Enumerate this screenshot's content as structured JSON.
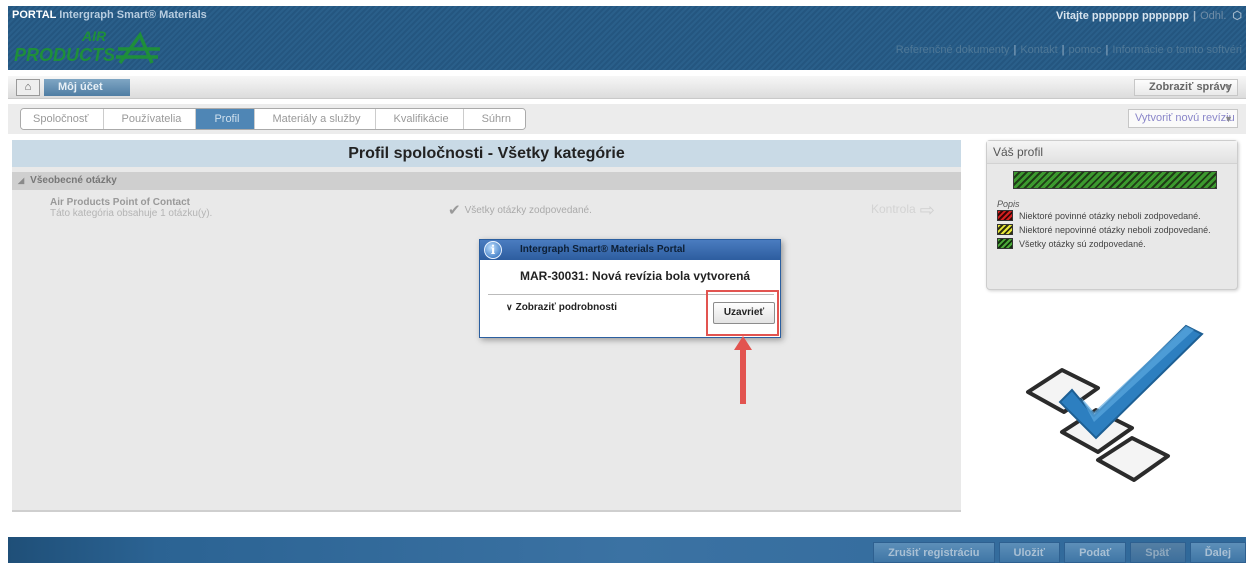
{
  "header": {
    "portal_label": "PORTAL",
    "app_name": "Intergraph Smart® Materials",
    "logo_text_top": "AIR",
    "logo_text_bottom": "PRODUCTS",
    "welcome": "Vitajte ppppppp ppppppp",
    "logout": "Odhl.",
    "links": [
      "Referenčné dokumenty",
      "Kontakt",
      "pomoc",
      "Informácie o tomto softvéri"
    ]
  },
  "account_bar": {
    "my_account_tab": "Môj účet",
    "show_messages": "Zobraziť správy"
  },
  "wizard": {
    "steps": [
      {
        "label": "Spoločnosť",
        "active": false
      },
      {
        "label": "Používatelia",
        "active": false
      },
      {
        "label": "Profil",
        "active": true
      },
      {
        "label": "Materiály a služby",
        "active": false
      },
      {
        "label": "Kvalifikácie",
        "active": false
      },
      {
        "label": "Súhrn",
        "active": false
      }
    ],
    "create_revision": "Vytvoriť novú revíziu"
  },
  "main": {
    "page_title": "Profil spoločnosti - Všetky kategórie",
    "section": "Všeobecné otázky",
    "category": {
      "name": "Air Products Point of Contact",
      "description": "Táto kategória obsahuje 1 otázku(y).",
      "status": "Všetky otázky zodpovedané.",
      "review": "Kontrola"
    }
  },
  "profile_panel": {
    "title": "Váš profil",
    "progress_fraction": 1.0,
    "legend_title": "Popis",
    "legend": [
      {
        "label": "Niektoré povinné otázky neboli zodpovedané.",
        "color": "#d62020"
      },
      {
        "label": "Niektoré nepovinné otázky neboli zodpovedané.",
        "color": "#e8e83a"
      },
      {
        "label": "Všetky otázky sú zodpovedané.",
        "color": "#4caa3a"
      }
    ]
  },
  "modal": {
    "title": "Intergraph Smart® Materials Portal",
    "message": "MAR-30031: Nová revízia bola vytvorená",
    "details_toggle": "Zobraziť podrobnosti",
    "close_button": "Uzavrieť"
  },
  "footer": {
    "buttons": [
      {
        "label": "Zrušiť registráciu",
        "disabled": false
      },
      {
        "label": "Uložiť",
        "disabled": false
      },
      {
        "label": "Podať",
        "disabled": false
      },
      {
        "label": "Späť",
        "disabled": true
      },
      {
        "label": "Ďalej",
        "disabled": false
      }
    ]
  },
  "colors": {
    "header_blue": "#245680",
    "logo_green": "#1e8f3a",
    "annotation_red": "#e25450",
    "modal_header": "#2d5d9f"
  }
}
